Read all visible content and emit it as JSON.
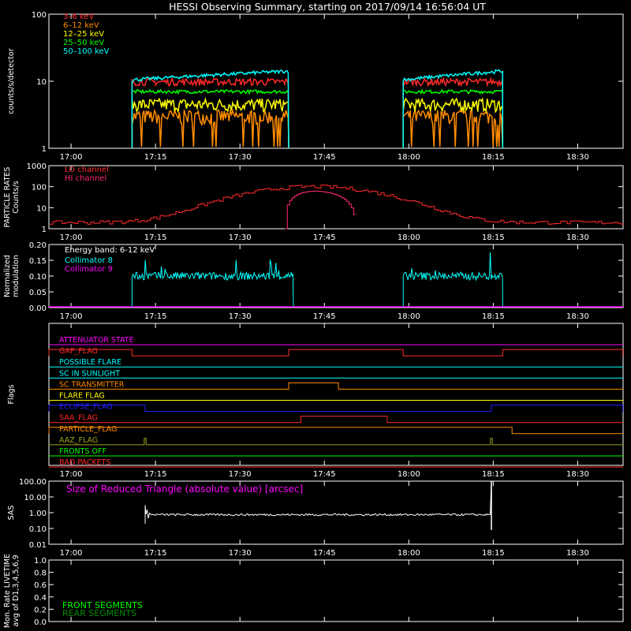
{
  "title": "HESSI Observing Summary, starting on 2017/09/14 16:56:04 UT",
  "time_ticks": [
    "17:00",
    "17:15",
    "17:30",
    "17:45",
    "18:00",
    "18:15",
    "18:30"
  ],
  "chart_data": [
    {
      "id": "count_rates",
      "type": "line",
      "ylabel": "counts/s/detector",
      "yscale": "log",
      "ylim": [
        1,
        100
      ],
      "yticks": [
        "1",
        "10",
        "100"
      ],
      "x_unit": "UT",
      "series": [
        {
          "name": "3–6 keV",
          "color": "#ff2a2a",
          "level": 9.8,
          "segments": [
            [
              "17:10:50",
              "17:38:40"
            ],
            [
              "17:59:00",
              "18:16:40"
            ]
          ]
        },
        {
          "name": "6–12 keV",
          "color": "#ff8c00",
          "level": 3.0,
          "segments": [
            [
              "17:10:50",
              "17:38:40"
            ],
            [
              "17:59:00",
              "18:16:40"
            ]
          ]
        },
        {
          "name": "12–25 keV",
          "color": "#ffff00",
          "level": 4.5,
          "segments": [
            [
              "17:10:50",
              "17:38:40"
            ],
            [
              "17:59:00",
              "18:16:40"
            ]
          ]
        },
        {
          "name": "25–50 keV",
          "color": "#00ff00",
          "level": 7.0,
          "segments": [
            [
              "17:10:50",
              "17:38:40"
            ],
            [
              "17:59:00",
              "18:16:40"
            ]
          ]
        },
        {
          "name": "50–100 keV",
          "color": "#00ffff",
          "level": 10.5,
          "segments": [
            [
              "17:10:50",
              "17:38:40"
            ],
            [
              "17:59:00",
              "18:16:40"
            ]
          ]
        }
      ]
    },
    {
      "id": "particle_rates",
      "type": "line",
      "ylabel": "PARTICLE RATES\nCounts/s",
      "yscale": "log",
      "ylim": [
        1,
        1000
      ],
      "yticks": [
        "1",
        "10",
        "100",
        "1000"
      ],
      "series": [
        {
          "name": "LO channel",
          "color": "#ff2a2a"
        },
        {
          "name": "HI channel",
          "color": "#ff2a6a"
        }
      ]
    },
    {
      "id": "modulation",
      "type": "line",
      "ylabel": "Normalized\nmodulation",
      "ylim": [
        0,
        0.2
      ],
      "yticks": [
        "0.00",
        "0.05",
        "0.10",
        "0.15",
        "0.20"
      ],
      "annotation": "Energy band: 6-12 keV",
      "series": [
        {
          "name": "Collimator 8",
          "color": "#00ffff",
          "level": 0.1,
          "segments": [
            [
              "17:10:50",
              "17:39:30"
            ],
            [
              "17:59:00",
              "18:16:40"
            ]
          ]
        },
        {
          "name": "Collimator 9",
          "color": "#ff00ff",
          "level": 0.0
        }
      ]
    },
    {
      "id": "flags",
      "type": "line",
      "ylabel": "Flags",
      "flags": [
        {
          "name": "ATTENUATOR STATE",
          "color": "#ff00ff",
          "high": []
        },
        {
          "name": "GAP_FLAG",
          "color": "#ff2a2a",
          "high": [
            [
              "16:56:04",
              "17:10:50"
            ],
            [
              "17:38:40",
              "17:59:00"
            ],
            [
              "18:16:40",
              "18:38:00"
            ]
          ]
        },
        {
          "name": "POSSIBLE FLARE",
          "color": "#00ffff",
          "high": []
        },
        {
          "name": "SC IN SUNLIGHT",
          "color": "#00ffff",
          "high": []
        },
        {
          "name": "SC TRANSMITTER",
          "color": "#ff8c00",
          "high": [
            [
              "17:38:40",
              "17:47:30"
            ]
          ]
        },
        {
          "name": "FLARE FLAG",
          "color": "#ffff00",
          "high": []
        },
        {
          "name": "ECLIPSE_FLAG",
          "color": "#2020ff",
          "high": [
            [
              "16:56:04",
              "17:13:10"
            ],
            [
              "18:14:40",
              "18:38:00"
            ]
          ]
        },
        {
          "name": "SAA_FLAG",
          "color": "#ff2a2a",
          "high": [
            [
              "17:40:50",
              "17:56:10"
            ]
          ]
        },
        {
          "name": "PARTICLE_FLAG",
          "color": "#ff8c00",
          "high": [
            [
              "16:56:04",
              "18:18:20"
            ]
          ]
        },
        {
          "name": "AAZ_FLAG",
          "color": "#a0a020",
          "high": [
            [
              "17:13:00",
              "17:13:20"
            ],
            [
              "18:14:30",
              "18:14:50"
            ]
          ]
        },
        {
          "name": "FRONTS OFF",
          "color": "#00ff00",
          "high": []
        },
        {
          "name": "BAD PACKETS",
          "color": "#ff2a2a",
          "high": []
        }
      ]
    },
    {
      "id": "sas",
      "type": "line",
      "ylabel": "SAS",
      "yscale": "log",
      "ylim": [
        0.01,
        100
      ],
      "yticks": [
        "0.01",
        "0.10",
        "1.00",
        "10.00",
        "100.00"
      ],
      "annotation": "Size of Reduced Triangle (absolute value) [arcsec]",
      "series": [
        {
          "name": "Size of Reduced Triangle (absolute value) [arcsec]",
          "color": "#ffffff",
          "level": 0.75,
          "segments": [
            [
              "17:13:10",
              "18:14:40"
            ]
          ]
        }
      ]
    },
    {
      "id": "livetime",
      "type": "line",
      "ylabel": "Mon. Rate LIVETIME\navg of D1,3,4,5,6,9",
      "ylim": [
        0,
        1
      ],
      "yticks": [
        "0.0",
        "0.2",
        "0.4",
        "0.6",
        "0.8",
        "1.0"
      ],
      "series": [
        {
          "name": "FRONT SEGMENTS",
          "color": "#00ff00"
        },
        {
          "name": "REAR SEGMENTS",
          "color": "#008c00"
        }
      ]
    }
  ]
}
